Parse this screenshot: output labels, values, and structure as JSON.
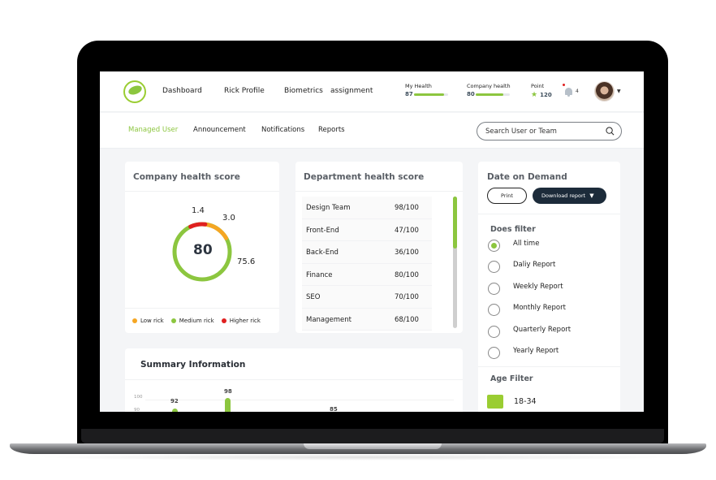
{
  "nav": {
    "links": [
      "Dashboard",
      "Rick Profile",
      "Biometrics",
      "assignment"
    ],
    "my_health": {
      "label": "My Health",
      "value": "87",
      "percent": 87
    },
    "company_health": {
      "label": "Company health",
      "value": "80",
      "percent": 80
    },
    "points": {
      "label": "Point",
      "value": "120",
      "icon": "star-icon"
    },
    "notifications": {
      "count": "4",
      "icon": "bell-icon"
    },
    "avatar": {
      "icon": "user-avatar"
    }
  },
  "subnav": {
    "links": [
      "Managed User",
      "Announcement",
      "Notifications",
      "Reports"
    ],
    "active": "Managed User",
    "search_placeholder": "Search User or Team"
  },
  "company_health": {
    "title": "Company health score",
    "center_value": "80",
    "segments": [
      {
        "label": "Higher rick",
        "value": "1.4",
        "color": "#e02020"
      },
      {
        "label": "Low rick",
        "value": "3.0",
        "color": "#f5a623"
      },
      {
        "label": "Medium rick",
        "value": "75.6",
        "color": "#8cc63f"
      }
    ],
    "legend": [
      {
        "label": "Low rick",
        "color": "#f5a623"
      },
      {
        "label": "Medium rick",
        "color": "#8cc63f"
      },
      {
        "label": "Higher rick",
        "color": "#e02020"
      }
    ]
  },
  "department_health": {
    "title": "Department health score",
    "rows": [
      {
        "name": "Design Team",
        "score": "98/100"
      },
      {
        "name": "Front-End",
        "score": "47/100"
      },
      {
        "name": "Back-End",
        "score": "36/100"
      },
      {
        "name": "Finance",
        "score": "80/100"
      },
      {
        "name": "SEO",
        "score": "70/100"
      },
      {
        "name": "Management",
        "score": "68/100"
      }
    ]
  },
  "date_on_demand": {
    "title": "Date on Demand",
    "print_label": "Print",
    "download_label": "Download report",
    "filter_title": "Does filter",
    "options": [
      "All time",
      "Daliy Report",
      "Weekly Report",
      "Monthly Report",
      "Quarterly Report",
      "Yearly Report"
    ],
    "selected": "All time",
    "age_filter_title": "Age Filter",
    "age_options": [
      {
        "label": "18-34",
        "color": "#9acd32"
      }
    ]
  },
  "summary": {
    "title": "Summary Information",
    "axis_labels": [
      "100",
      "90"
    ],
    "bars": [
      {
        "value": "92"
      },
      {
        "value": "98"
      },
      {
        "value": "85"
      }
    ]
  },
  "colors": {
    "accent": "#8cc63f",
    "dark": "#1c2b3a"
  }
}
